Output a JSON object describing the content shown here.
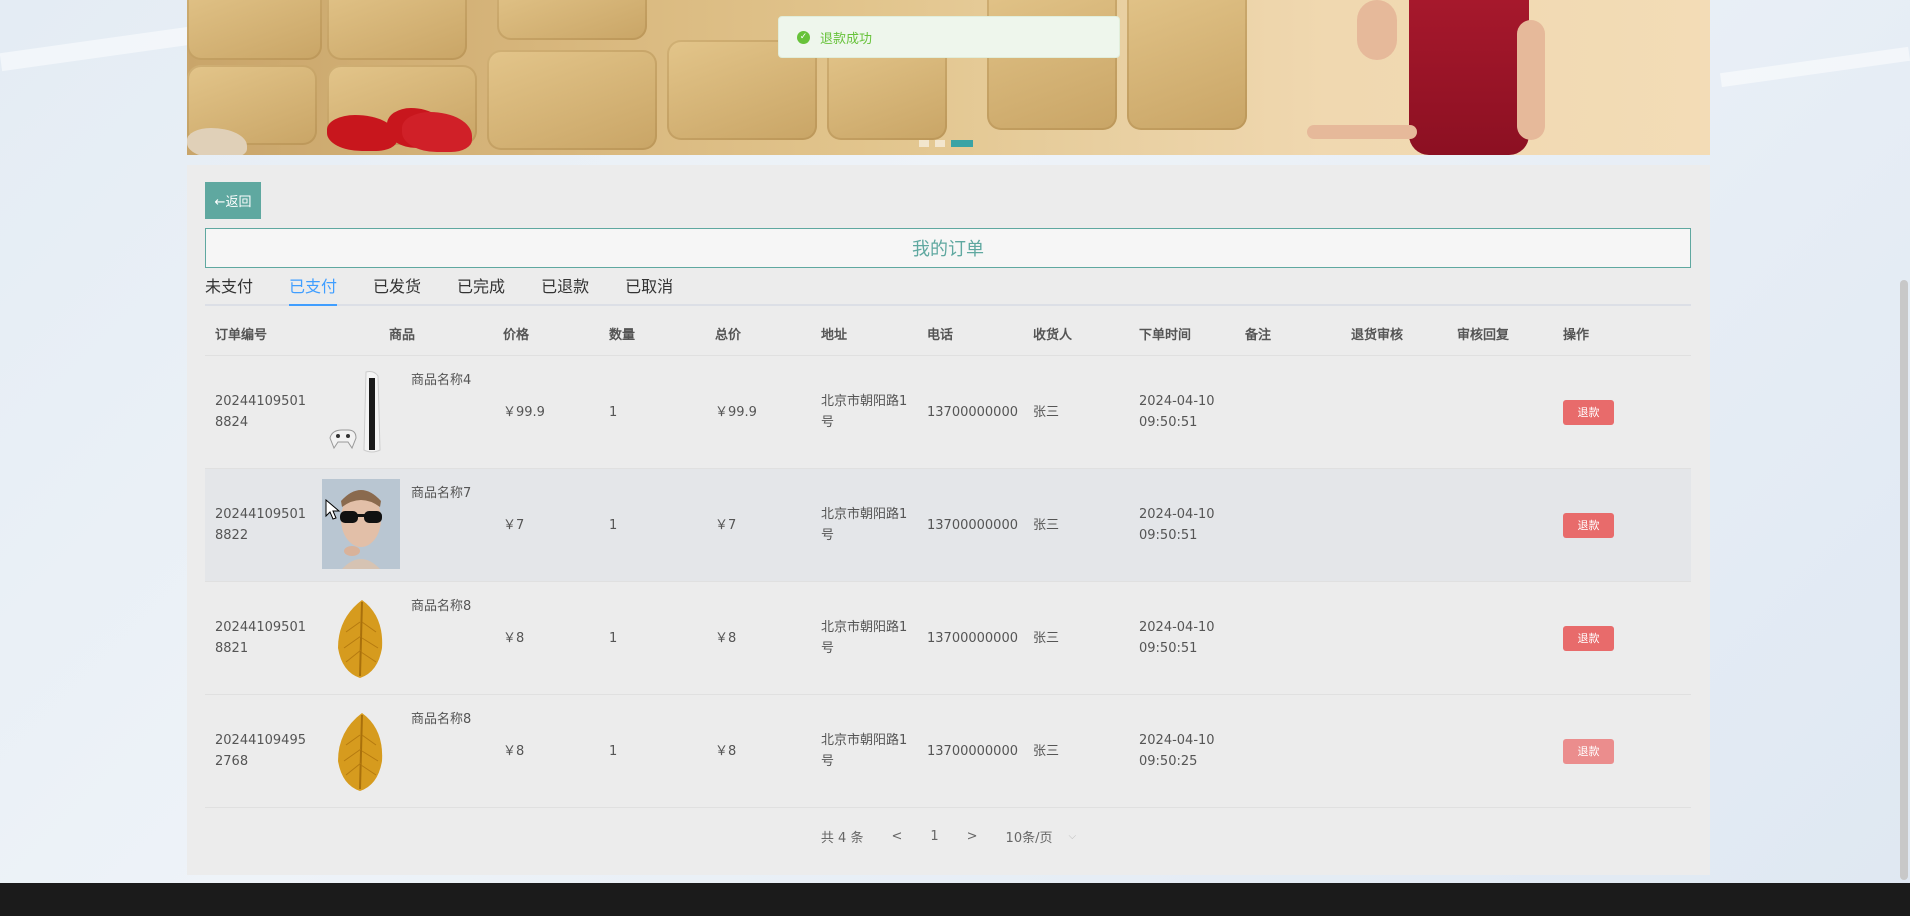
{
  "toast": {
    "message": "退款成功"
  },
  "back_button": {
    "label": "←返回"
  },
  "page_title": "我的订单",
  "tabs": [
    {
      "label": "未支付"
    },
    {
      "label": "已支付"
    },
    {
      "label": "已发货"
    },
    {
      "label": "已完成"
    },
    {
      "label": "已退款"
    },
    {
      "label": "已取消"
    }
  ],
  "active_tab": "已支付",
  "table": {
    "headers": {
      "id": "订单编号",
      "goods": "商品",
      "price": "价格",
      "qty": "数量",
      "total": "总价",
      "addr": "地址",
      "tel": "电话",
      "recv": "收货人",
      "time": "下单时间",
      "note": "备注",
      "audit": "退货审核",
      "reply": "审核回复",
      "op": "操作"
    },
    "rows": [
      {
        "id": "202441095018824",
        "goods": "商品名称4",
        "image": "game-console",
        "price": "￥99.9",
        "qty": "1",
        "total": "￥99.9",
        "addr": "北京市朝阳路1号",
        "tel": "13700000000",
        "recv": "张三",
        "time": "2024-04-10 09:50:51",
        "note": "",
        "audit": "",
        "reply": "",
        "op": "退款"
      },
      {
        "id": "202441095018822",
        "goods": "商品名称7",
        "image": "sunglasses-man",
        "price": "￥7",
        "qty": "1",
        "total": "￥7",
        "addr": "北京市朝阳路1号",
        "tel": "13700000000",
        "recv": "张三",
        "time": "2024-04-10 09:50:51",
        "note": "",
        "audit": "",
        "reply": "",
        "op": "退款"
      },
      {
        "id": "202441095018821",
        "goods": "商品名称8",
        "image": "dried-leaf",
        "price": "￥8",
        "qty": "1",
        "total": "￥8",
        "addr": "北京市朝阳路1号",
        "tel": "13700000000",
        "recv": "张三",
        "time": "2024-04-10 09:50:51",
        "note": "",
        "audit": "",
        "reply": "",
        "op": "退款"
      },
      {
        "id": "202441094952768",
        "goods": "商品名称8",
        "image": "dried-leaf",
        "price": "￥8",
        "qty": "1",
        "total": "￥8",
        "addr": "北京市朝阳路1号",
        "tel": "13700000000",
        "recv": "张三",
        "time": "2024-04-10 09:50:25",
        "note": "",
        "audit": "",
        "reply": "",
        "op": "退款"
      }
    ]
  },
  "pagination": {
    "total": "共 4 条",
    "prev": "<",
    "page": "1",
    "next": ">",
    "page_size": "10条/页"
  },
  "colors": {
    "accent": "#5fa8a0",
    "tab_active": "#409eff",
    "refund": "#e86b6b",
    "toast_text": "#67c23a"
  }
}
